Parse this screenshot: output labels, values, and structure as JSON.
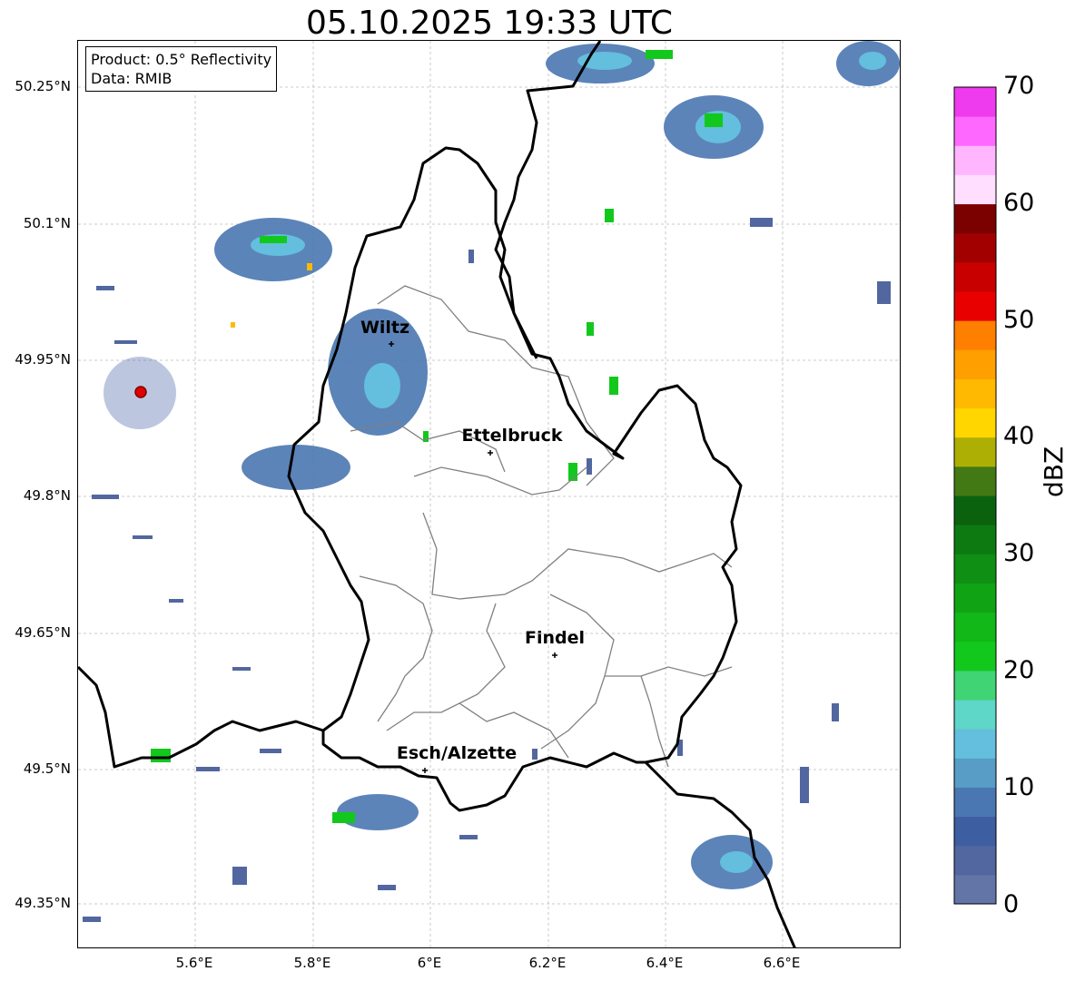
{
  "title": "05.10.2025 19:33 UTC",
  "info": {
    "product": "Product: 0.5° Reflectivity",
    "data": "Data: RMIB"
  },
  "lat_labels": [
    "50.25°N",
    "50.1°N",
    "49.95°N",
    "49.8°N",
    "49.65°N",
    "49.5°N",
    "49.35°N"
  ],
  "lon_labels": [
    "5.6°E",
    "5.8°E",
    "6°E",
    "6.2°E",
    "6.4°E",
    "6.6°E"
  ],
  "colorbar": {
    "label": "dBZ",
    "ticks": [
      "0",
      "10",
      "20",
      "30",
      "40",
      "50",
      "60",
      "70"
    ],
    "colors": [
      "#6374a7",
      "#52679f",
      "#3e5ea2",
      "#4a77b1",
      "#579dc6",
      "#64bedd",
      "#5ed6c8",
      "#40d474",
      "#13c81c",
      "#11b817",
      "#10a414",
      "#0f8f13",
      "#0d7a11",
      "#0b620e",
      "#437915",
      "#aeaf05",
      "#ffd600",
      "#ffb900",
      "#ff9f00",
      "#ff7f00",
      "#e80000",
      "#c80000",
      "#a20000",
      "#7b0000",
      "#ffdeff",
      "#ffb6ff",
      "#ff68ff",
      "#ee3bee"
    ]
  },
  "cities": [
    "Wiltz",
    "Ettelbruck",
    "Findel",
    "Esch/Alzette"
  ],
  "radar_site": "red circle marker"
}
